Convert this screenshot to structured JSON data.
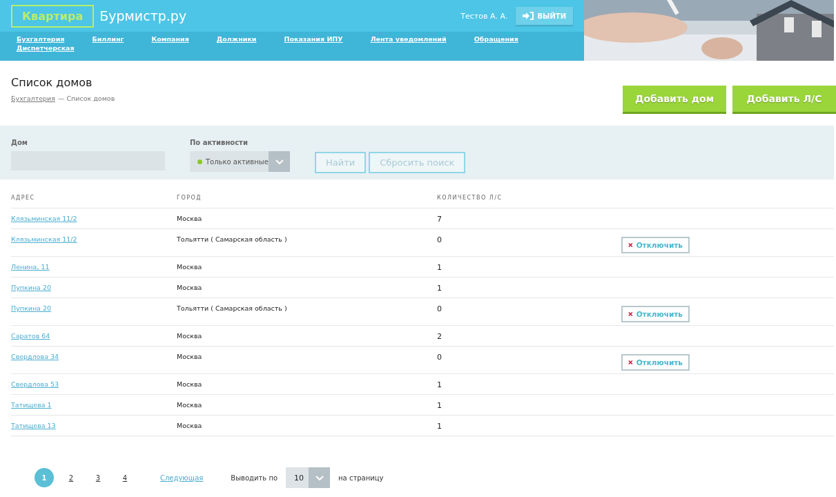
{
  "header": {
    "logo_badge": "Квартира",
    "logo_text": "Бурмистр.ру",
    "user": "Тестов А. А.",
    "logout": "ВЫЙТИ",
    "nav": [
      {
        "label": "Бухгалтерия",
        "selected": false
      },
      {
        "label": "Биллинг",
        "selected": false
      },
      {
        "label": "Компания",
        "selected": false
      },
      {
        "label": "Должники",
        "selected": false
      },
      {
        "label": "Показания ИПУ",
        "selected": false
      },
      {
        "label": "Лента уведомлений",
        "selected": false
      },
      {
        "label": "Обращения",
        "selected": false
      },
      {
        "label": "Диспетчерская",
        "selected": false
      }
    ]
  },
  "page": {
    "title": "Список домов",
    "breadcrumb": [
      {
        "label": "Бухгалтерия",
        "kind": "link"
      },
      {
        "label": "— Список домов",
        "kind": "text"
      }
    ],
    "buttons": [
      "Добавить дом",
      "Добавить Л/С"
    ]
  },
  "filter": {
    "house_label": "Дом",
    "activity_label": "По активности",
    "activity_value": "Только активные",
    "search": "Найти",
    "reset": "Сбросить поиск"
  },
  "table": {
    "columns": [
      "АДРЕС",
      "ГОРОД",
      "КОЛИЧЕСТВО Л/С"
    ],
    "rows": [
      {
        "address": "Клязьминская 11/2",
        "city": "Москва",
        "count": "7"
      },
      {
        "address": "Клязьминская 11/2",
        "city": "Тольятти ( Самарская область )",
        "count": "0",
        "action": "Отключить"
      },
      {
        "address": "Ленина, 11",
        "city": "Москва",
        "count": "1"
      },
      {
        "address": "Пупкина 20",
        "city": "Москва",
        "count": "1"
      },
      {
        "address": "Пупкина 20",
        "city": "Тольятти ( Самарская область )",
        "count": "0",
        "action": "Отключить"
      },
      {
        "address": "Саратов 64",
        "city": "Москва",
        "count": "2"
      },
      {
        "address": "Свердлова 34",
        "city": "Москва",
        "count": "0",
        "action": "Отключить"
      },
      {
        "address": "Свердлова 53",
        "city": "Москва",
        "count": "1"
      },
      {
        "address": "Татищева 1",
        "city": "Москва",
        "count": "1"
      },
      {
        "address": "Татищева 13",
        "city": "Москва",
        "count": "1"
      }
    ]
  },
  "pagination": {
    "pages": [
      {
        "label": "1",
        "selected": true
      },
      {
        "label": "2",
        "selected": false
      },
      {
        "label": "3",
        "selected": false
      },
      {
        "label": "4",
        "selected": false
      }
    ],
    "next": "Следующая",
    "per_page_label": "Выводить по",
    "per_page": "10",
    "per_page_suffix": "на страницу"
  }
}
